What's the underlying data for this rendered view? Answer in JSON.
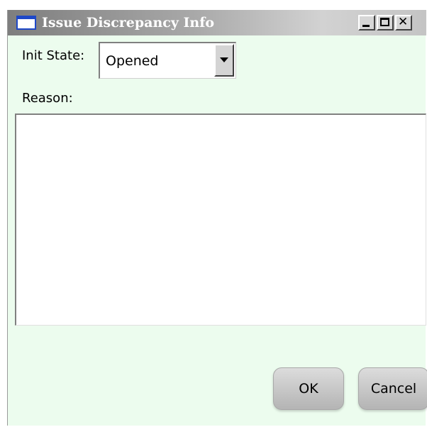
{
  "window": {
    "title": "Issue Discrepancy Info",
    "icon": "app-window-icon",
    "controls": {
      "minimize_icon": "minimize-icon",
      "maximize_icon": "maximize-icon",
      "close_icon": "close-icon",
      "close_glyph": "✕"
    }
  },
  "form": {
    "init_state": {
      "label": "Init State:",
      "value": "Opened"
    },
    "reason": {
      "label": "Reason:",
      "value": ""
    }
  },
  "buttons": {
    "ok_label": "OK",
    "cancel_label": "Cancel"
  },
  "colors": {
    "dialog_background": "#ecfcee",
    "titlebar_text": "#ffffff",
    "icon_accent": "#1e48c8"
  }
}
